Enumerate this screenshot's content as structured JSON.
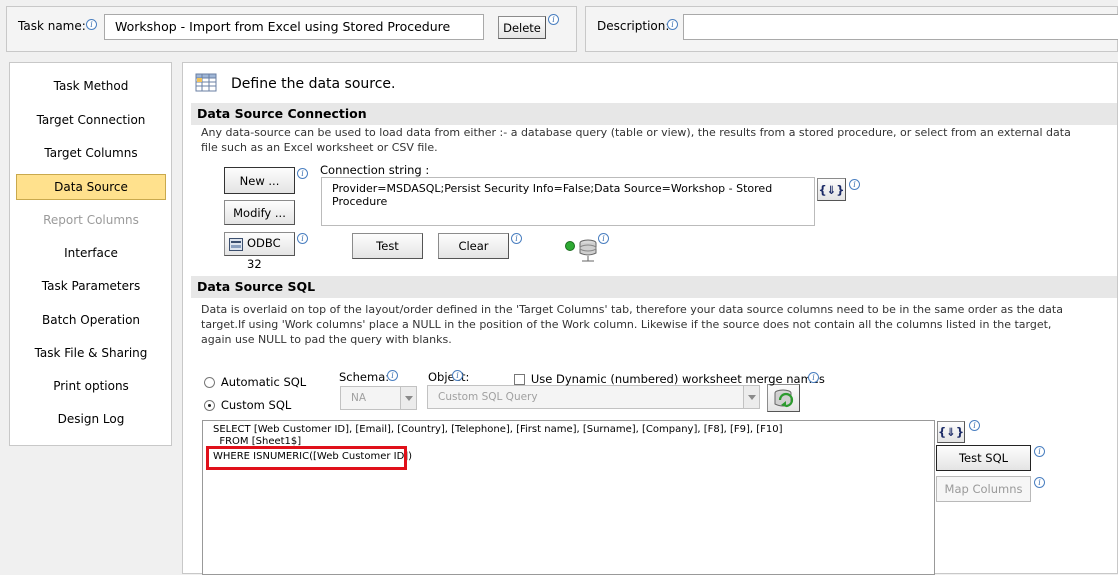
{
  "header": {
    "task_name_label": "Task name:",
    "task_name_value": "Workshop - Import from Excel using Stored Procedure",
    "delete_label": "Delete",
    "description_label": "Description:",
    "description_value": ""
  },
  "sidebar": {
    "items": [
      {
        "label": "Task Method",
        "state": "normal"
      },
      {
        "label": "Target Connection",
        "state": "normal"
      },
      {
        "label": "Target Columns",
        "state": "normal"
      },
      {
        "label": "Data Source",
        "state": "active"
      },
      {
        "label": "Report Columns",
        "state": "disabled"
      },
      {
        "label": "Interface",
        "state": "normal"
      },
      {
        "label": "Task Parameters",
        "state": "normal"
      },
      {
        "label": "Batch Operation",
        "state": "normal"
      },
      {
        "label": "Task File & Sharing",
        "state": "normal"
      },
      {
        "label": "Print options",
        "state": "normal"
      },
      {
        "label": "Design Log",
        "state": "normal"
      }
    ]
  },
  "page": {
    "heading": "Define the data source."
  },
  "connection": {
    "section_title": "Data Source Connection",
    "description": "Any data-source can be used to load data from either :- a database query (table or view), the results from a stored procedure, or select from an external data file such as an Excel worksheet or CSV file.",
    "new_label": "New ...",
    "modify_label": "Modify ...",
    "odbc_label": "ODBC 32",
    "conn_string_label": "Connection string :",
    "conn_string_value": "Provider=MSDASQL;Persist Security Info=False;Data Source=Workshop - Stored Procedure",
    "test_label": "Test",
    "clear_label": "Clear"
  },
  "sql": {
    "section_title": "Data Source SQL",
    "description": "Data is overlaid on top of the layout/order defined in the 'Target Columns' tab,  therefore your data source columns need to be in the same order as the data target.If using 'Work columns' place a NULL in the position of the Work column.  Likewise if the source does not contain all the columns listed in the target, again use NULL to pad the query with blanks.",
    "automatic_label": "Automatic SQL",
    "custom_label": "Custom SQL",
    "schema_label": "Schema:",
    "schema_value": "NA",
    "object_label": "Object:",
    "object_value": "Custom SQL Query",
    "dynamic_label": "Use Dynamic (numbered) worksheet merge names",
    "query_lines": [
      "SELECT [Web Customer ID], [Email], [Country], [Telephone], [First name], [Surname], [Company], [F8], [F9], [F10]",
      "  FROM [Sheet1$]",
      "WHERE ISNUMERIC([Web Customer ID])"
    ],
    "test_sql_label": "Test SQL",
    "map_columns_label": "Map Columns"
  },
  "colors": {
    "active_nav": "#ffe18d",
    "highlight_box": "#e0101a",
    "section_bar": "#e7e7e7"
  }
}
